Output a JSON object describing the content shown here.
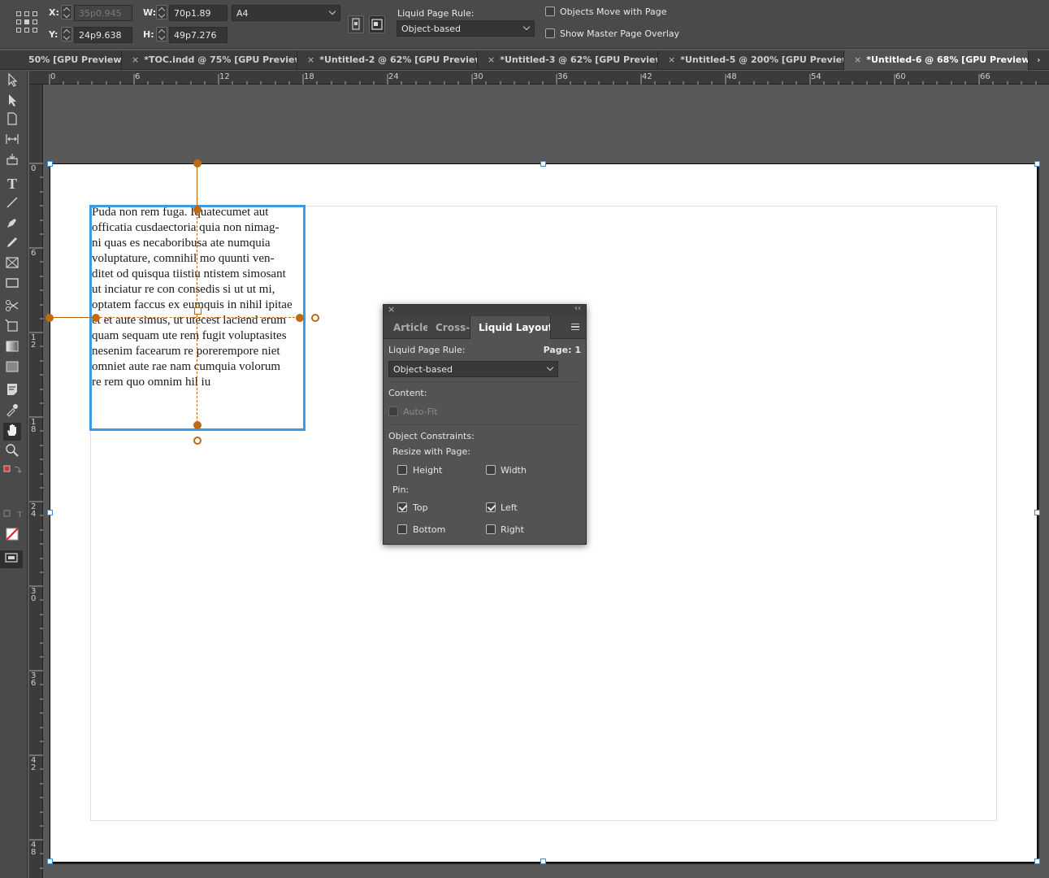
{
  "control_bar": {
    "x_label": "X:",
    "x_value": "35p0.945",
    "y_label": "Y:",
    "y_value": "24p9.638",
    "w_label": "W:",
    "w_value": "70p1.89",
    "h_label": "H:",
    "h_value": "49p7.276",
    "page_size": "A4",
    "liquid_page_rule_label": "Liquid Page Rule:",
    "liquid_page_rule_value": "Object-based",
    "objects_move_label": "Objects Move with Page",
    "show_master_label": "Show Master Page Overlay"
  },
  "tabs": [
    {
      "label": "50% [GPU Preview]",
      "close": ""
    },
    {
      "label": "*TOC.indd @ 75% [GPU Preview]",
      "close": "×"
    },
    {
      "label": "*Untitled-2 @ 62% [GPU Preview]",
      "close": "×"
    },
    {
      "label": "*Untitled-3 @ 62% [GPU Preview]",
      "close": "×"
    },
    {
      "label": "*Untitled-5 @ 200% [GPU Preview]",
      "close": "×"
    },
    {
      "label": "*Untitled-6 @ 68% [GPU Preview]",
      "close": "×"
    }
  ],
  "tab_overflow": "›",
  "ruler": {
    "h_ticks": [
      "0",
      "6",
      "12",
      "18",
      "24",
      "30",
      "36",
      "42",
      "48",
      "54",
      "60",
      "66"
    ],
    "v_ticks": [
      "0",
      "6",
      "1\n2",
      "1\n8",
      "2\n4",
      "3\n0",
      "3\n6",
      "4\n2",
      "4\n8"
    ]
  },
  "text_frame": {
    "lines": [
      "Puda non rem fuga. Iquatecumet aut",
      "officatia cusdaectoria quia non nimag-",
      "ni quas es necaboribusa ate numquia",
      "voluptature, comnihil mo quunti ven-",
      "ditet od quisqua tiistiu ntistem simosant",
      "ut inciatur re con consedis si ut ut mi,",
      "optatem faccus ex eumquis in nihil ipitae",
      "et et aute simus, ut utecest laciend erum",
      "quam sequam ute rem fugit voluptasites",
      "nesenim facearum re porerempore niet",
      "omniet aute rae nam cumquia volorum",
      "re rem quo omnim hil iu"
    ]
  },
  "panel": {
    "close": "×",
    "collapse": "‹‹",
    "tabs": [
      "Article",
      "Cross-",
      "Liquid Layout"
    ],
    "liquid_page_rule_label": "Liquid Page Rule:",
    "page_label": "Page: 1",
    "rule_value": "Object-based",
    "content_label": "Content:",
    "auto_fit_label": "Auto-Fit",
    "object_constraints_label": "Object Constraints:",
    "resize_label": "Resize with Page:",
    "height_label": "Height",
    "width_label": "Width",
    "pin_label": "Pin:",
    "top_label": "Top",
    "left_label": "Left",
    "bottom_label": "Bottom",
    "right_label": "Right",
    "checks": {
      "height": false,
      "width": false,
      "top": true,
      "left": true,
      "bottom": false,
      "right": false,
      "auto_fit": false
    }
  },
  "colors": {
    "accent_frame": "#3a9be6",
    "liquid_guide": "#c06a10"
  }
}
